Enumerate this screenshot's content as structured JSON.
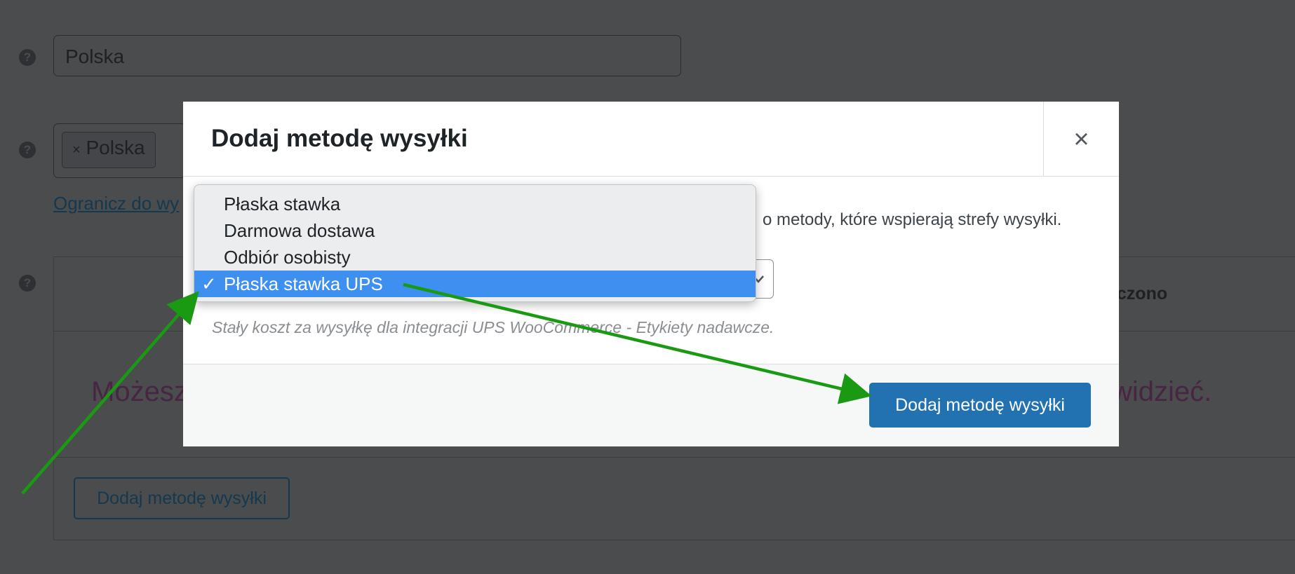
{
  "background": {
    "country_field_value": "Polska",
    "region_chip_label": "Polska",
    "region_chip_remove": "×",
    "limit_link": "Ogranicz do wy",
    "table_header_partial": "ączono",
    "empty_message_left": "Możesz",
    "empty_message_right": "widzieć.",
    "add_method_button": "Dodaj metodę wysyłki",
    "help_glyph": "?"
  },
  "modal": {
    "title": "Dodaj metodę wysyłki",
    "close_glyph": "×",
    "intro_text_visible": "o metody, które wspierają strefy wysyłki.",
    "description": "Stały koszt za wysyłkę dla integracji UPS WooCommerce - Etykiety nadawcze.",
    "submit_label": "Dodaj metodę wysyłki"
  },
  "dropdown": {
    "check_glyph": "✓",
    "selected": "Płaska stawka UPS",
    "options": [
      "Płaska stawka",
      "Darmowa dostawa",
      "Odbiór osobisty",
      "Płaska stawka UPS"
    ]
  },
  "colors": {
    "primary": "#2271b1",
    "selection": "#3d8ff0",
    "annotation_arrow": "#1a9a12",
    "overlay": "#4b4c4e"
  },
  "icons": [
    "help-icon",
    "close-icon",
    "remove-icon",
    "chevron-down-icon",
    "checkmark-icon",
    "arrow-annotation"
  ]
}
